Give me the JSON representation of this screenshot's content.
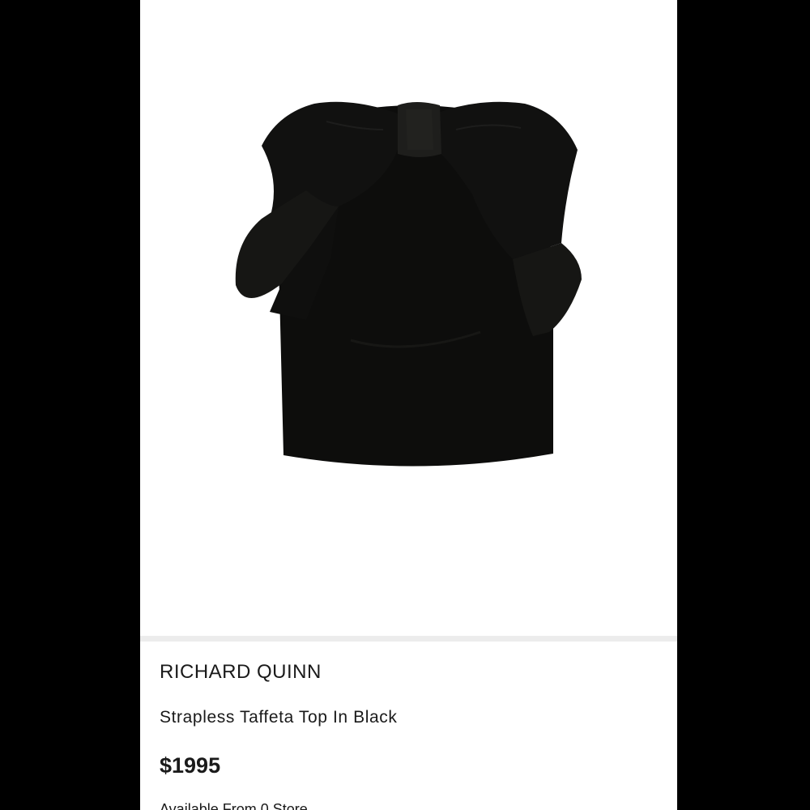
{
  "product": {
    "brand": "RICHARD QUINN",
    "title": "Strapless Taffeta Top In Black",
    "price": "$1995",
    "availability": "Available From 0 Store"
  },
  "image": {
    "alt": "Strapless Taffeta Top In Black",
    "garment_color": "#0d0d0c"
  },
  "icons": {
    "top_right": "square-outline-icon"
  }
}
